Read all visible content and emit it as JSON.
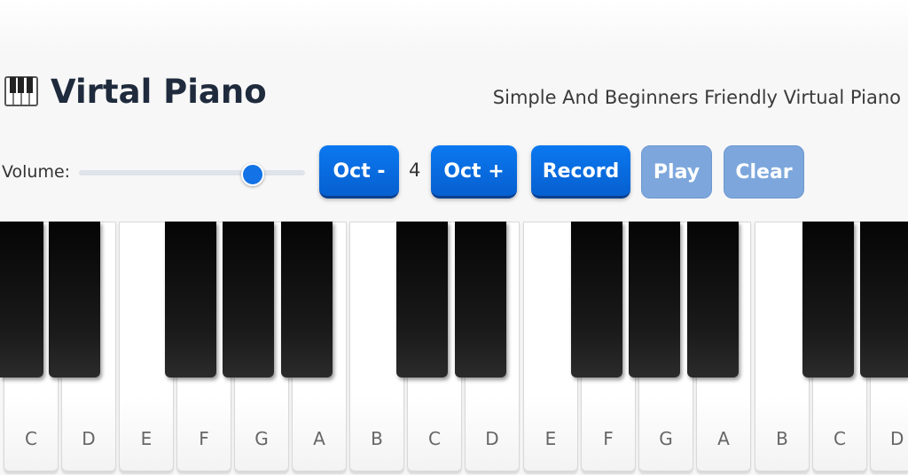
{
  "header": {
    "title": "Virtal Piano",
    "tagline": "Simple And Beginners Friendly Virtual Piano",
    "logo_icon": "piano-keys-icon"
  },
  "controls": {
    "volume_label": "Volume:",
    "volume_level": 0.77,
    "octave_down_label": "Oct -",
    "octave_value": "4",
    "octave_up_label": "Oct +",
    "record_label": "Record",
    "play_label": "Play",
    "clear_label": "Clear"
  },
  "colors": {
    "accent": "#0b6fe6",
    "disabled_button": "#7da7dc",
    "title": "#1f2b3d"
  },
  "keyboard": {
    "white_keys": [
      "C",
      "D",
      "E",
      "F",
      "G",
      "A",
      "B",
      "C",
      "D",
      "E",
      "F",
      "G",
      "A",
      "B",
      "C",
      "D"
    ]
  }
}
